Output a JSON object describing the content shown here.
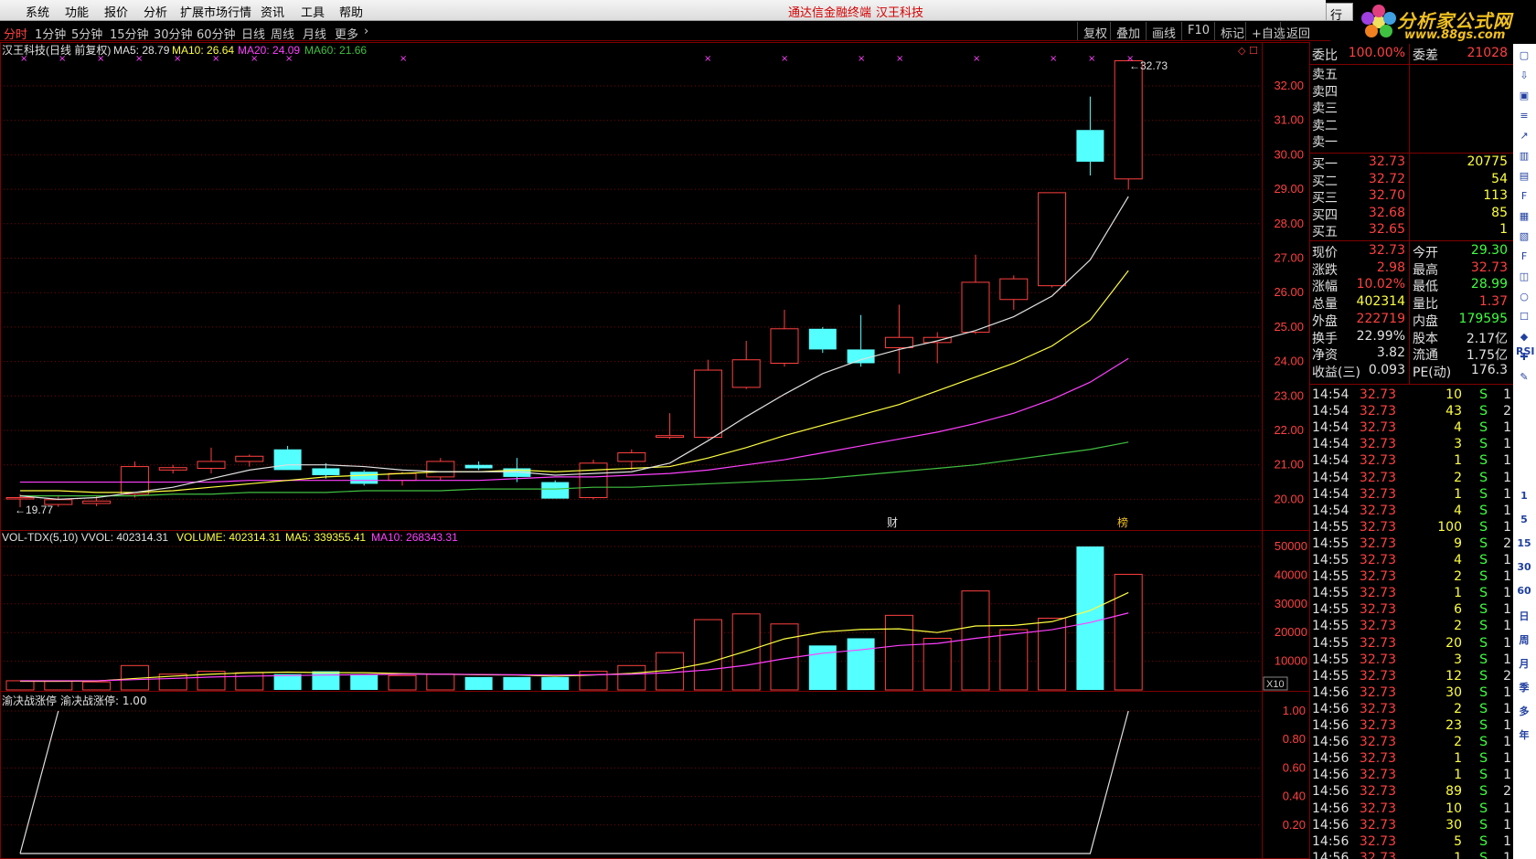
{
  "menu": {
    "items": [
      "系统",
      "功能",
      "报价",
      "分析",
      "扩展市场行情",
      "资讯",
      "工具",
      "帮助"
    ],
    "center_app": "通达信金融终端",
    "center_stock": "汉王科技",
    "trade_btn": "行"
  },
  "logo": {
    "title": "分析家公式网",
    "url": "www.88gs.com"
  },
  "periods": [
    "分时",
    "1分钟",
    "5分钟",
    "15分钟",
    "30分钟",
    "60分钟",
    "日线",
    "周线",
    "月线",
    "更多"
  ],
  "right_buttons": [
    "复权",
    "叠加",
    "画线",
    "F10",
    "标记",
    "+自选",
    "返回"
  ],
  "main_chart": {
    "header_name": "汉王科技(日线 前复权)",
    "ma5_label": "MA5: 28.79",
    "ma10_label": "MA10: 26.64",
    "ma20_label": "MA20: 24.09",
    "ma60_label": "MA60: 21.66",
    "price_ticks": [
      "32.00",
      "31.00",
      "30.00",
      "29.00",
      "28.00",
      "27.00",
      "26.00",
      "25.00",
      "24.00",
      "23.00",
      "22.00",
      "21.00",
      "20.00"
    ],
    "high_label": "32.73",
    "low_label": "19.77",
    "markers": [
      "财",
      "榜"
    ]
  },
  "vol_chart": {
    "header": "VOL-TDX(5,10)",
    "vvol": "VVOL: 402314.31",
    "volume": "VOLUME: 402314.31",
    "ma5": "MA5: 339355.41",
    "ma10": "MA10: 268343.31",
    "ticks": [
      "50000",
      "40000",
      "30000",
      "20000",
      "10000"
    ],
    "unit": "X10"
  },
  "ind_chart": {
    "header": "渝决战涨停",
    "value": "渝决战涨停: 1.00",
    "ticks": [
      "1.00",
      "0.80",
      "0.60",
      "0.40",
      "0.20"
    ]
  },
  "chart_data": {
    "type": "candlestick",
    "candles": [
      {
        "o": 20.02,
        "h": 20.15,
        "l": 19.77,
        "c": 20.05
      },
      {
        "o": 19.85,
        "h": 20.08,
        "l": 19.78,
        "c": 19.99
      },
      {
        "o": 19.88,
        "h": 20.1,
        "l": 19.8,
        "c": 19.95
      },
      {
        "o": 20.15,
        "h": 21.1,
        "l": 20.05,
        "c": 20.95
      },
      {
        "o": 20.85,
        "h": 21.0,
        "l": 20.75,
        "c": 20.92
      },
      {
        "o": 20.9,
        "h": 21.5,
        "l": 20.75,
        "c": 21.1
      },
      {
        "o": 21.1,
        "h": 21.3,
        "l": 20.95,
        "c": 21.25
      },
      {
        "o": 21.45,
        "h": 21.55,
        "l": 20.85,
        "c": 20.85
      },
      {
        "o": 20.9,
        "h": 21.05,
        "l": 20.6,
        "c": 20.7
      },
      {
        "o": 20.8,
        "h": 20.85,
        "l": 20.4,
        "c": 20.45
      },
      {
        "o": 20.55,
        "h": 20.8,
        "l": 20.4,
        "c": 20.75
      },
      {
        "o": 20.65,
        "h": 21.2,
        "l": 20.55,
        "c": 21.1
      },
      {
        "o": 21.0,
        "h": 21.1,
        "l": 20.85,
        "c": 20.9
      },
      {
        "o": 20.9,
        "h": 21.2,
        "l": 20.5,
        "c": 20.65
      },
      {
        "o": 20.5,
        "h": 20.55,
        "l": 20.02,
        "c": 20.02
      },
      {
        "o": 20.05,
        "h": 21.15,
        "l": 20.0,
        "c": 21.05
      },
      {
        "o": 21.1,
        "h": 21.45,
        "l": 20.85,
        "c": 21.35
      },
      {
        "o": 21.8,
        "h": 22.5,
        "l": 21.75,
        "c": 21.85
      },
      {
        "o": 21.8,
        "h": 24.05,
        "l": 21.75,
        "c": 23.75
      },
      {
        "o": 23.25,
        "h": 24.6,
        "l": 23.2,
        "c": 24.05
      },
      {
        "o": 23.95,
        "h": 25.5,
        "l": 23.85,
        "c": 24.95
      },
      {
        "o": 24.95,
        "h": 25.0,
        "l": 24.25,
        "c": 24.35
      },
      {
        "o": 24.35,
        "h": 25.35,
        "l": 23.85,
        "c": 23.95
      },
      {
        "o": 24.4,
        "h": 25.65,
        "l": 23.65,
        "c": 24.7
      },
      {
        "o": 24.55,
        "h": 24.85,
        "l": 23.95,
        "c": 24.7
      },
      {
        "o": 24.85,
        "h": 27.1,
        "l": 24.8,
        "c": 26.3
      },
      {
        "o": 25.8,
        "h": 26.5,
        "l": 25.5,
        "c": 26.4
      },
      {
        "o": 26.2,
        "h": 28.9,
        "l": 26.15,
        "c": 28.9
      },
      {
        "o": 30.72,
        "h": 31.69,
        "l": 29.4,
        "c": 29.8
      },
      {
        "o": 29.3,
        "h": 32.73,
        "l": 28.99,
        "c": 32.73
      }
    ],
    "ma5": [
      20.1,
      20.0,
      20.05,
      20.2,
      20.35,
      20.6,
      20.85,
      21.0,
      21.0,
      20.95,
      20.85,
      20.8,
      20.8,
      20.8,
      20.7,
      20.75,
      20.8,
      21.05,
      21.7,
      22.4,
      23.05,
      23.65,
      24.05,
      24.35,
      24.6,
      24.9,
      25.3,
      25.9,
      26.95,
      28.79
    ],
    "ma10": [
      20.25,
      20.25,
      20.2,
      20.2,
      20.25,
      20.35,
      20.45,
      20.55,
      20.65,
      20.7,
      20.75,
      20.8,
      20.8,
      20.85,
      20.8,
      20.85,
      20.9,
      20.95,
      21.2,
      21.5,
      21.85,
      22.15,
      22.45,
      22.75,
      23.15,
      23.55,
      23.95,
      24.45,
      25.2,
      26.64
    ],
    "ma20": [
      20.5,
      20.5,
      20.5,
      20.5,
      20.5,
      20.5,
      20.55,
      20.55,
      20.55,
      20.55,
      20.55,
      20.55,
      20.55,
      20.6,
      20.65,
      20.65,
      20.7,
      20.75,
      20.85,
      21.0,
      21.15,
      21.35,
      21.55,
      21.75,
      21.95,
      22.2,
      22.5,
      22.9,
      23.4,
      24.09
    ],
    "ma60": [
      20.1,
      20.1,
      20.1,
      20.1,
      20.15,
      20.15,
      20.2,
      20.2,
      20.2,
      20.25,
      20.25,
      20.25,
      20.3,
      20.3,
      20.3,
      20.35,
      20.35,
      20.4,
      20.45,
      20.5,
      20.55,
      20.6,
      20.7,
      20.8,
      20.9,
      21.0,
      21.15,
      21.3,
      21.45,
      21.66
    ],
    "volume": [
      3200,
      3000,
      2800,
      8500,
      5500,
      6500,
      6000,
      5500,
      6500,
      5500,
      5000,
      5500,
      4500,
      4500,
      4500,
      6500,
      8500,
      13000,
      24500,
      26500,
      23000,
      15500,
      18000,
      26000,
      18000,
      34500,
      21000,
      25000,
      50000,
      40300
    ],
    "vol_ma5": [
      3000,
      3000,
      3100,
      4000,
      4800,
      5500,
      6000,
      6200,
      6000,
      6000,
      5700,
      5500,
      5300,
      5200,
      4800,
      5200,
      5800,
      6900,
      9500,
      13500,
      17800,
      20200,
      21100,
      21300,
      20000,
      22300,
      22500,
      23800,
      27700,
      33930
    ],
    "vol_ma10": [
      3200,
      3200,
      3200,
      3600,
      4000,
      4500,
      4800,
      5000,
      5200,
      5300,
      5500,
      5500,
      5400,
      5300,
      5200,
      5300,
      5500,
      6000,
      7000,
      8600,
      10900,
      12800,
      14000,
      15500,
      16200,
      18000,
      19500,
      21000,
      23500,
      26830
    ],
    "indicator": [
      0,
      0,
      0,
      0,
      0,
      0,
      0,
      0,
      0,
      0,
      0,
      0,
      0,
      0,
      0,
      0,
      0,
      0,
      0,
      0,
      0,
      0,
      0,
      0,
      0,
      0,
      0,
      0,
      0,
      1.0
    ]
  },
  "right_panel": {
    "weibi": {
      "label": "委比",
      "value": "100.00%",
      "label2": "委差",
      "value2": "21028"
    },
    "sells": [
      "卖五",
      "卖四",
      "卖三",
      "卖二",
      "卖一"
    ],
    "buys": [
      {
        "label": "买一",
        "price": "32.73",
        "vol": "20775"
      },
      {
        "label": "买二",
        "price": "32.72",
        "vol": "54"
      },
      {
        "label": "买三",
        "price": "32.70",
        "vol": "113"
      },
      {
        "label": "买四",
        "price": "32.68",
        "vol": "85"
      },
      {
        "label": "买五",
        "price": "32.65",
        "vol": "1"
      }
    ],
    "quotes": [
      {
        "l1": "现价",
        "v1": "32.73",
        "c1": "#ff4040",
        "l2": "今开",
        "v2": "29.30",
        "c2": "#40ff40"
      },
      {
        "l1": "涨跌",
        "v1": "2.98",
        "c1": "#ff4040",
        "l2": "最高",
        "v2": "32.73",
        "c2": "#ff4040"
      },
      {
        "l1": "涨幅",
        "v1": "10.02%",
        "c1": "#ff4040",
        "l2": "最低",
        "v2": "28.99",
        "c2": "#40ff40"
      },
      {
        "l1": "总量",
        "v1": "402314",
        "c1": "#ffff40",
        "l2": "量比",
        "v2": "1.37",
        "c2": "#ff4040"
      },
      {
        "l1": "外盘",
        "v1": "222719",
        "c1": "#ff4040",
        "l2": "内盘",
        "v2": "179595",
        "c2": "#40ff40"
      },
      {
        "l1": "换手",
        "v1": "22.99%",
        "c1": "#e0e0e0",
        "l2": "股本",
        "v2": "2.17亿",
        "c2": "#e0e0e0"
      },
      {
        "l1": "净资",
        "v1": "3.82",
        "c1": "#e0e0e0",
        "l2": "流通",
        "v2": "1.75亿",
        "c2": "#e0e0e0"
      },
      {
        "l1": "收益(三)",
        "v1": "0.093",
        "c1": "#e0e0e0",
        "l2": "PE(动)",
        "v2": "176.3",
        "c2": "#e0e0e0"
      }
    ],
    "ticks": [
      {
        "t": "14:54",
        "p": "32.73",
        "v": "10",
        "s": "S",
        "n": "1"
      },
      {
        "t": "14:54",
        "p": "32.73",
        "v": "43",
        "s": "S",
        "n": "2"
      },
      {
        "t": "14:54",
        "p": "32.73",
        "v": "4",
        "s": "S",
        "n": "1"
      },
      {
        "t": "14:54",
        "p": "32.73",
        "v": "3",
        "s": "S",
        "n": "1"
      },
      {
        "t": "14:54",
        "p": "32.73",
        "v": "1",
        "s": "S",
        "n": "1"
      },
      {
        "t": "14:54",
        "p": "32.73",
        "v": "2",
        "s": "S",
        "n": "1"
      },
      {
        "t": "14:54",
        "p": "32.73",
        "v": "1",
        "s": "S",
        "n": "1"
      },
      {
        "t": "14:54",
        "p": "32.73",
        "v": "4",
        "s": "S",
        "n": "1"
      },
      {
        "t": "14:55",
        "p": "32.73",
        "v": "100",
        "s": "S",
        "n": "1"
      },
      {
        "t": "14:55",
        "p": "32.73",
        "v": "9",
        "s": "S",
        "n": "2"
      },
      {
        "t": "14:55",
        "p": "32.73",
        "v": "4",
        "s": "S",
        "n": "1"
      },
      {
        "t": "14:55",
        "p": "32.73",
        "v": "2",
        "s": "S",
        "n": "1"
      },
      {
        "t": "14:55",
        "p": "32.73",
        "v": "1",
        "s": "S",
        "n": "1"
      },
      {
        "t": "14:55",
        "p": "32.73",
        "v": "6",
        "s": "S",
        "n": "1"
      },
      {
        "t": "14:55",
        "p": "32.73",
        "v": "2",
        "s": "S",
        "n": "1"
      },
      {
        "t": "14:55",
        "p": "32.73",
        "v": "20",
        "s": "S",
        "n": "1"
      },
      {
        "t": "14:55",
        "p": "32.73",
        "v": "3",
        "s": "S",
        "n": "1"
      },
      {
        "t": "14:55",
        "p": "32.73",
        "v": "12",
        "s": "S",
        "n": "2"
      },
      {
        "t": "14:56",
        "p": "32.73",
        "v": "30",
        "s": "S",
        "n": "1"
      },
      {
        "t": "14:56",
        "p": "32.73",
        "v": "2",
        "s": "S",
        "n": "1"
      },
      {
        "t": "14:56",
        "p": "32.73",
        "v": "23",
        "s": "S",
        "n": "1"
      },
      {
        "t": "14:56",
        "p": "32.73",
        "v": "2",
        "s": "S",
        "n": "1"
      },
      {
        "t": "14:56",
        "p": "32.73",
        "v": "1",
        "s": "S",
        "n": "1"
      },
      {
        "t": "14:56",
        "p": "32.73",
        "v": "1",
        "s": "S",
        "n": "1"
      },
      {
        "t": "14:56",
        "p": "32.73",
        "v": "89",
        "s": "S",
        "n": "2"
      },
      {
        "t": "14:56",
        "p": "32.73",
        "v": "10",
        "s": "S",
        "n": "1"
      },
      {
        "t": "14:56",
        "p": "32.73",
        "v": "30",
        "s": "S",
        "n": "1"
      },
      {
        "t": "14:56",
        "p": "32.73",
        "v": "5",
        "s": "S",
        "n": "1"
      },
      {
        "t": "14:56",
        "p": "32.73",
        "v": "1",
        "s": "S",
        "n": "1"
      }
    ]
  },
  "side_icons": [
    "1",
    "5",
    "15",
    "30",
    "60",
    "日",
    "周",
    "月",
    "年",
    "多",
    "季",
    "RSI"
  ],
  "colors": {
    "up": "#ff4040",
    "down": "#54ffff",
    "ma5": "#e0e0e0",
    "ma10": "#ffff40",
    "ma20": "#ff40ff",
    "ma60": "#40c040",
    "grid": "#800000"
  }
}
